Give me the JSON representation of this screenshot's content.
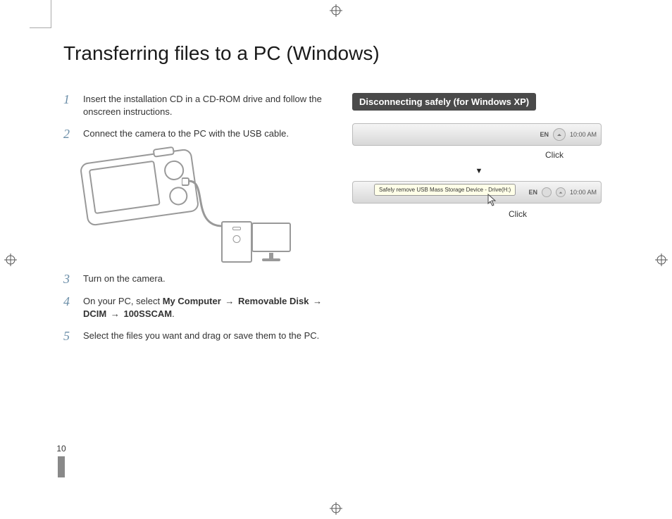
{
  "title": "Transferring files to a PC (Windows)",
  "steps": {
    "s1": {
      "num": "1",
      "text": "Insert the installation CD in a CD-ROM drive and follow the onscreen instructions."
    },
    "s2": {
      "num": "2",
      "text": "Connect the camera to the PC with the USB cable."
    },
    "s3": {
      "num": "3",
      "text": "Turn on the camera."
    },
    "s4": {
      "num": "4",
      "lead": "On your PC, select ",
      "b1": "My Computer",
      "b2": "Removable Disk",
      "b3": "DCIM",
      "b4": "100SSCAM",
      "arrow": "→",
      "tail": "."
    },
    "s5": {
      "num": "5",
      "text": "Select the files you want and drag or save them to the PC."
    }
  },
  "right": {
    "header": "Disconnecting safely (for Windows XP)",
    "click": "Click",
    "lang": "EN",
    "time": "10:00 AM",
    "tooltip": "Safely remove USB Mass Storage Device - Drive(H:)",
    "down": "▼"
  },
  "page_number": "10"
}
